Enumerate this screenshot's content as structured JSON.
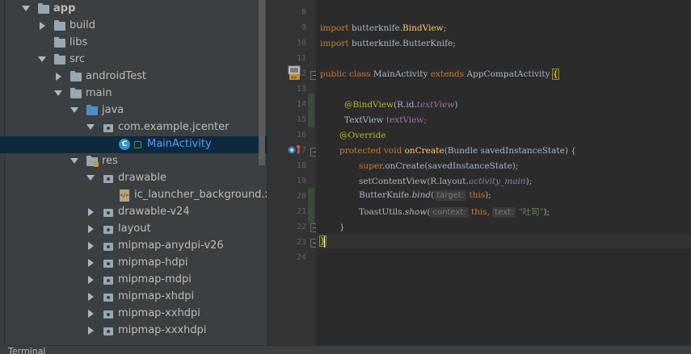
{
  "project_tree": {
    "items": [
      {
        "label": "app",
        "expanded": true,
        "icon": "folder-icon"
      },
      {
        "label": "build",
        "expanded": false,
        "icon": "folder-icon"
      },
      {
        "label": "libs",
        "expanded": null,
        "icon": "folder-icon"
      },
      {
        "label": "src",
        "expanded": true,
        "icon": "folder-icon"
      },
      {
        "label": "androidTest",
        "expanded": false,
        "icon": "folder-icon"
      },
      {
        "label": "main",
        "expanded": true,
        "icon": "folder-icon"
      },
      {
        "label": "java",
        "expanded": true,
        "icon": "source-folder-icon"
      },
      {
        "label": "com.example.jcenter",
        "expanded": true,
        "icon": "package-icon"
      },
      {
        "label": "MainActivity",
        "selected": true,
        "icon": "class-icon"
      },
      {
        "label": "res",
        "expanded": true,
        "icon": "resource-folder-icon"
      },
      {
        "label": "drawable",
        "expanded": true,
        "icon": "package-icon"
      },
      {
        "label": "ic_launcher_background.xml",
        "icon": "xml-file-icon"
      },
      {
        "label": "drawable-v24",
        "expanded": false,
        "icon": "package-icon"
      },
      {
        "label": "layout",
        "expanded": false,
        "icon": "package-icon"
      },
      {
        "label": "mipmap-anydpi-v26",
        "expanded": false,
        "icon": "package-icon"
      },
      {
        "label": "mipmap-hdpi",
        "expanded": false,
        "icon": "package-icon"
      },
      {
        "label": "mipmap-mdpi",
        "expanded": false,
        "icon": "package-icon"
      },
      {
        "label": "mipmap-xhdpi",
        "expanded": false,
        "icon": "package-icon"
      },
      {
        "label": "mipmap-xxhdpi",
        "expanded": false,
        "icon": "package-icon"
      },
      {
        "label": "mipmap-xxxhdpi",
        "expanded": false,
        "icon": "package-icon"
      }
    ]
  },
  "editor": {
    "line_numbers": [
      "8",
      "9",
      "10",
      "11",
      "12",
      "13",
      "14",
      "15",
      "16",
      "17",
      "18",
      "19",
      "20",
      "21",
      "22",
      "23",
      "24"
    ],
    "lines": {
      "l9_import": "import",
      "l9_pkg": " butterknife.",
      "l9_cls": "BindView",
      "l9_end": ";",
      "l10_import": "import",
      "l10_rest": " butterknife.ButterKnife;",
      "l12_mods": "public class",
      "l12_name": " MainActivity ",
      "l12_extends": "extends",
      "l12_super": " AppCompatActivity ",
      "l12_brace": "{",
      "l14_ann": "@BindView",
      "l14_args1": "(R.id.",
      "l14_field": "textView",
      "l14_args2": ")",
      "l15_type": "TextView ",
      "l15_name": "textView",
      "l15_end": ";",
      "l16_ann": "@Override",
      "l17_mods": "protected void",
      "l17_name": " onCreate",
      "l17_params": "(Bundle savedInstanceState) {",
      "l18_super": "super",
      "l18_rest": ".onCreate(savedInstanceState);",
      "l19_call": "setContentView(R.layout.",
      "l19_field": "activity_main",
      "l19_end": ");",
      "l20_cls": "ButterKnife.",
      "l20_method": "bind",
      "l20_open": "(",
      "l20_hint": "target:",
      "l20_this": " this",
      "l20_end": ");",
      "l21_cls": "ToastUtils.",
      "l21_method": "show",
      "l21_open": "(",
      "l21_hint1": "context:",
      "l21_this": " this",
      "l21_comma": ", ",
      "l21_hint2": "text:",
      "l21_str": " \"吐司\"",
      "l21_end": ");",
      "l22_brace": "}",
      "l23_brace": "}"
    }
  },
  "gutter_icons": [
    "android-activity-icon",
    "override-arrow-icon"
  ],
  "bottom_bar": {
    "label": "Terminal"
  },
  "colors": {
    "keyword": "#cc7832",
    "annotation": "#bbb529",
    "field": "#9876aa",
    "method": "#ffc66d",
    "string": "#6a8759",
    "selection": "#0d293e"
  }
}
